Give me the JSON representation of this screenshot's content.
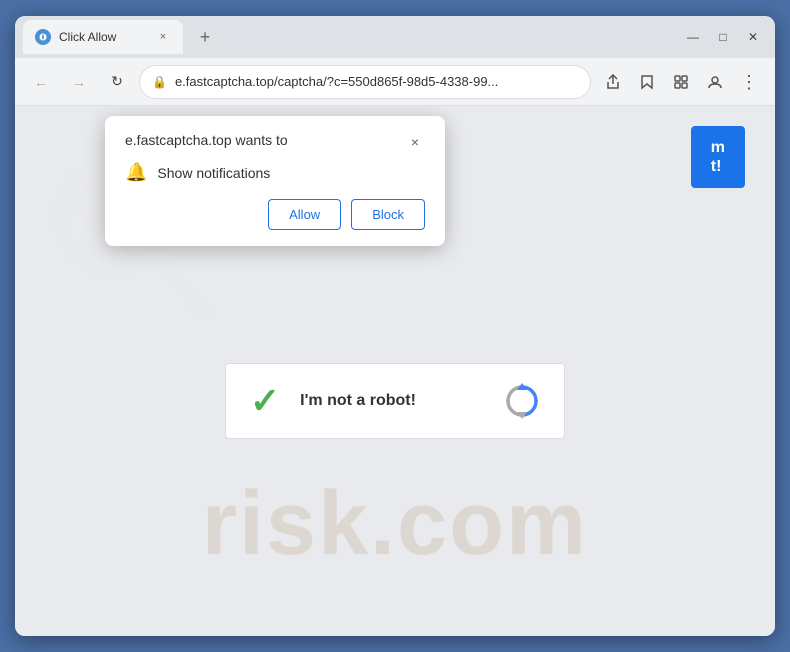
{
  "browser": {
    "title_bar": {
      "tab_title": "Click Allow",
      "close_label": "×",
      "new_tab_label": "+",
      "window_minimize": "—",
      "window_maximize": "□",
      "window_close": "✕"
    },
    "nav_bar": {
      "back_btn": "←",
      "forward_btn": "→",
      "reload_btn": "↻",
      "address": "e.fastcaptcha.top/captcha/?c=550d865f-98d5-4338-99...",
      "share_icon": "⬆",
      "bookmark_icon": "☆",
      "extension_icon": "□",
      "profile_icon": "👤",
      "more_icon": "⋮"
    }
  },
  "popup": {
    "title": "e.fastcaptcha.top wants to",
    "close_label": "×",
    "notification_label": "Show notifications",
    "allow_label": "Allow",
    "block_label": "Block"
  },
  "recaptcha": {
    "checkbox_label": "I'm not a robot!"
  },
  "watermark": {
    "text": "risk.com"
  }
}
